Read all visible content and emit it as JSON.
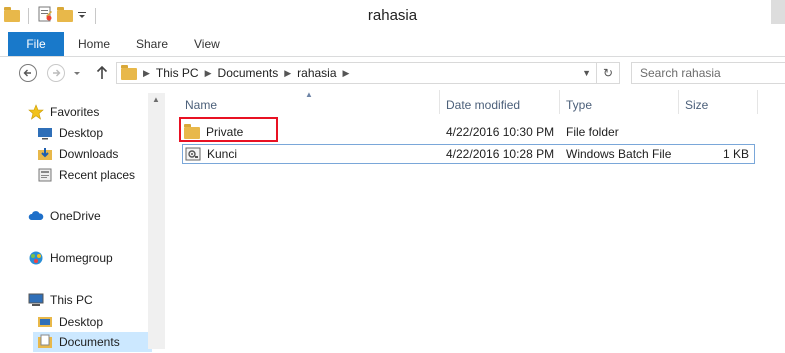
{
  "window": {
    "title": "rahasia"
  },
  "ribbon": {
    "tabs": [
      "File",
      "Home",
      "Share",
      "View"
    ]
  },
  "address": {
    "crumbs": [
      "This PC",
      "Documents",
      "rahasia"
    ],
    "search_placeholder": "Search rahasia"
  },
  "nav": {
    "items": [
      {
        "label": "Favorites",
        "icon": "star-icon"
      },
      {
        "label": "Desktop",
        "icon": "desktop-icon"
      },
      {
        "label": "Downloads",
        "icon": "downloads-icon"
      },
      {
        "label": "Recent places",
        "icon": "recent-places-icon"
      },
      {
        "label": "OneDrive",
        "icon": "cloud-icon"
      },
      {
        "label": "Homegroup",
        "icon": "homegroup-icon"
      },
      {
        "label": "This PC",
        "icon": "computer-icon"
      },
      {
        "label": "Desktop",
        "icon": "desktop-icon"
      },
      {
        "label": "Documents",
        "icon": "documents-icon"
      }
    ]
  },
  "columns": {
    "name": "Name",
    "date": "Date modified",
    "type": "Type",
    "size": "Size"
  },
  "files": [
    {
      "name": "Private",
      "date": "4/22/2016 10:30 PM",
      "type": "File folder",
      "size": ""
    },
    {
      "name": "Kunci",
      "date": "4/22/2016 10:28 PM",
      "type": "Windows Batch File",
      "size": "1 KB"
    }
  ],
  "colors": {
    "accent": "#1979ca",
    "selection": "#cce8ff",
    "highlight_box": "#e81123"
  }
}
